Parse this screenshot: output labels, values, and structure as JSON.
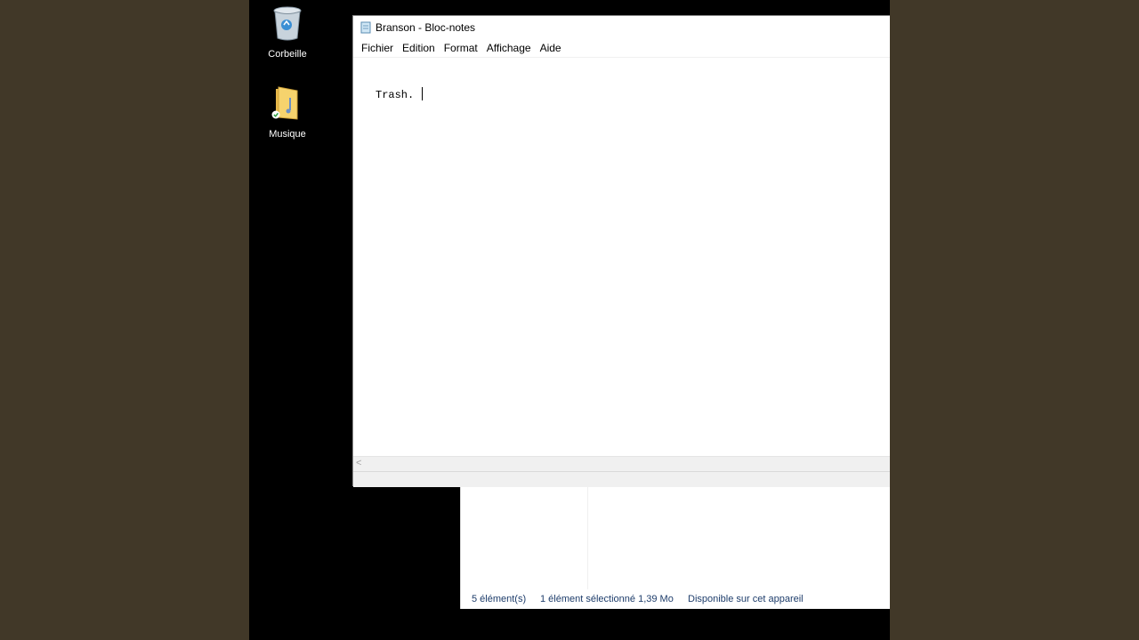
{
  "desktop": {
    "icons": [
      {
        "label": "Corbeille",
        "icon": "recycle-bin-icon"
      },
      {
        "label": "Musique",
        "icon": "music-folder-icon"
      }
    ]
  },
  "notepad": {
    "title": "Branson - Bloc-notes",
    "menu": [
      "Fichier",
      "Edition",
      "Format",
      "Affichage",
      "Aide"
    ],
    "content": "Trash. "
  },
  "explorer": {
    "status": {
      "items": "5 élément(s)",
      "selected": "1 élément sélectionné  1,39 Mo",
      "availability": "Disponible sur cet appareil"
    }
  },
  "colors": {
    "outer_bg": "#413828",
    "desktop_bg": "#000000",
    "explorer_status_text": "#1e3d6b"
  }
}
